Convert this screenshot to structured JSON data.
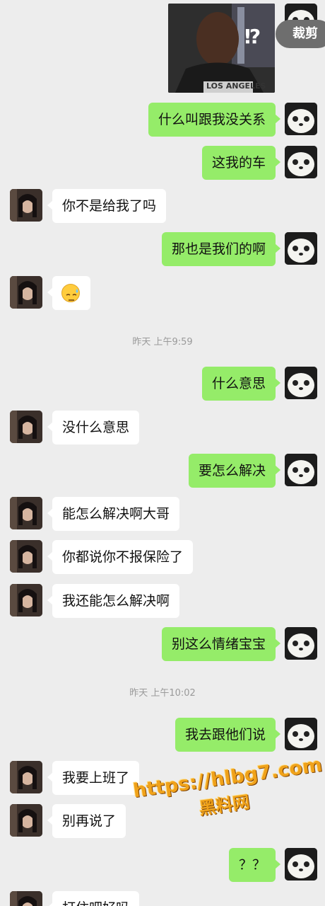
{
  "chat": {
    "crop_button_label": "裁剪",
    "sticker_text": "⁉",
    "sticker_jersey_text": "LOS ANGELES",
    "messages": [
      {
        "from": "me",
        "text": "什么叫跟我没关系"
      },
      {
        "from": "me",
        "text": "这我的车"
      },
      {
        "from": "other",
        "text": "你不是给我了吗"
      },
      {
        "from": "me",
        "text": "那也是我们的啊"
      },
      {
        "from": "other",
        "text": "😓"
      },
      {
        "type": "timestamp",
        "text": "昨天 上午9:59"
      },
      {
        "from": "me",
        "text": "什么意思"
      },
      {
        "from": "other",
        "text": "没什么意思"
      },
      {
        "from": "me",
        "text": "要怎么解决"
      },
      {
        "from": "other",
        "text": "能怎么解决啊大哥"
      },
      {
        "from": "other",
        "text": "你都说你不报保险了"
      },
      {
        "from": "other",
        "text": "我还能怎么解决啊"
      },
      {
        "from": "me",
        "text": "别这么情绪宝宝"
      },
      {
        "type": "timestamp",
        "text": "昨天 上午10:02"
      },
      {
        "from": "me",
        "text": "我去跟他们说"
      },
      {
        "from": "other",
        "text": "我要上班了"
      },
      {
        "from": "other",
        "text": "别再说了"
      },
      {
        "from": "me",
        "text": "？？"
      },
      {
        "from": "other",
        "text": "打住吧好吗"
      }
    ]
  },
  "watermark": {
    "url": "https://hlbg7.com",
    "name": "黑料网"
  },
  "colors": {
    "background": "#ededed",
    "my_bubble": "#95ec69",
    "other_bubble": "#ffffff",
    "timestamp_text": "#9a9a9a",
    "watermark": "#f0a21a"
  }
}
